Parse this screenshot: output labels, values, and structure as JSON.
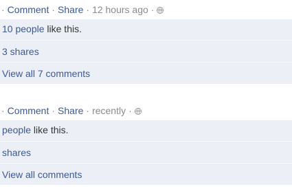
{
  "posts": [
    {
      "actions": {
        "separator": "·",
        "comment_label": "Comment",
        "share_label": "Share",
        "timestamp": "12 hours ago",
        "audience_icon": "globe-icon"
      },
      "likes": {
        "people_link": "10 people",
        "suffix": " like this."
      },
      "shares": "3 shares",
      "comments": "View all 7 comments"
    },
    {
      "actions": {
        "separator": "·",
        "comment_label": "Comment",
        "share_label": "Share",
        "timestamp": "recently",
        "audience_icon": "globe-icon"
      },
      "likes": {
        "people_link": "people",
        "suffix": " like this."
      },
      "shares": "shares",
      "comments": "View all comments"
    }
  ],
  "colors": {
    "link": "#3b5998",
    "meta": "#8a8a8a",
    "row_background": "#eceff5",
    "text": "#333333"
  }
}
